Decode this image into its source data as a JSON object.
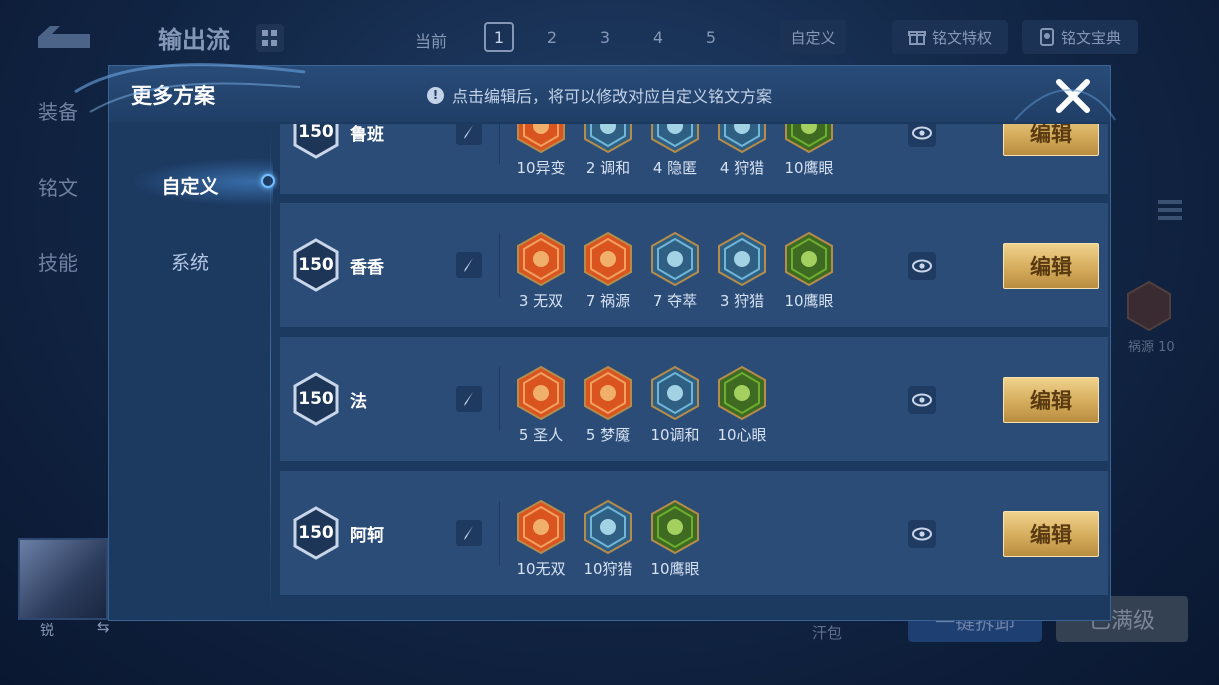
{
  "background": {
    "title": "输出流",
    "current_label": "当前",
    "slots": [
      "1",
      "2",
      "3",
      "4",
      "5"
    ],
    "active_slot": "1",
    "custom_label": "自定义",
    "privilege_label": "铭文特权",
    "treasure_label": "铭文宝典",
    "side_tabs": [
      "装备",
      "铭文",
      "技能"
    ],
    "rune_label": "祸源 10",
    "avatar_name": "锐",
    "avatar_swap": "⇆",
    "bottom_text": "汗包",
    "bottom_button1": "一键拆卸",
    "bottom_button2": "已满级"
  },
  "modal": {
    "title": "更多方案",
    "hint_icon": "info-icon",
    "hint": "点击编辑后，将可以修改对应自定义铭文方案",
    "close_icon": "close-icon",
    "sidebar": [
      {
        "label": "自定义",
        "active": true
      },
      {
        "label": "系统",
        "active": false
      }
    ]
  },
  "schemes": [
    {
      "level": "150",
      "name": "鲁班",
      "edit_label": "编辑",
      "runes": [
        {
          "label": "10异变",
          "kind": "red"
        },
        {
          "label": "2 调和",
          "kind": "blue"
        },
        {
          "label": "4 隐匿",
          "kind": "blue"
        },
        {
          "label": "4 狩猎",
          "kind": "blue"
        },
        {
          "label": "10鹰眼",
          "kind": "green"
        }
      ]
    },
    {
      "level": "150",
      "name": "香香",
      "edit_label": "编辑",
      "runes": [
        {
          "label": "3 无双",
          "kind": "red"
        },
        {
          "label": "7 祸源",
          "kind": "red"
        },
        {
          "label": "7 夺萃",
          "kind": "blue"
        },
        {
          "label": "3 狩猎",
          "kind": "blue"
        },
        {
          "label": "10鹰眼",
          "kind": "green"
        }
      ]
    },
    {
      "level": "150",
      "name": "法",
      "edit_label": "编辑",
      "runes": [
        {
          "label": "5 圣人",
          "kind": "red"
        },
        {
          "label": "5 梦魇",
          "kind": "red"
        },
        {
          "label": "10调和",
          "kind": "blue"
        },
        {
          "label": "10心眼",
          "kind": "green"
        }
      ]
    },
    {
      "level": "150",
      "name": "阿轲",
      "edit_label": "编辑",
      "runes": [
        {
          "label": "10无双",
          "kind": "red"
        },
        {
          "label": "10狩猎",
          "kind": "blue"
        },
        {
          "label": "10鹰眼",
          "kind": "green"
        }
      ]
    }
  ],
  "colors": {
    "red": "#d9541e",
    "blue": "#6fb6d8",
    "green": "#6cae2f",
    "gold": "#d5ac5c"
  }
}
